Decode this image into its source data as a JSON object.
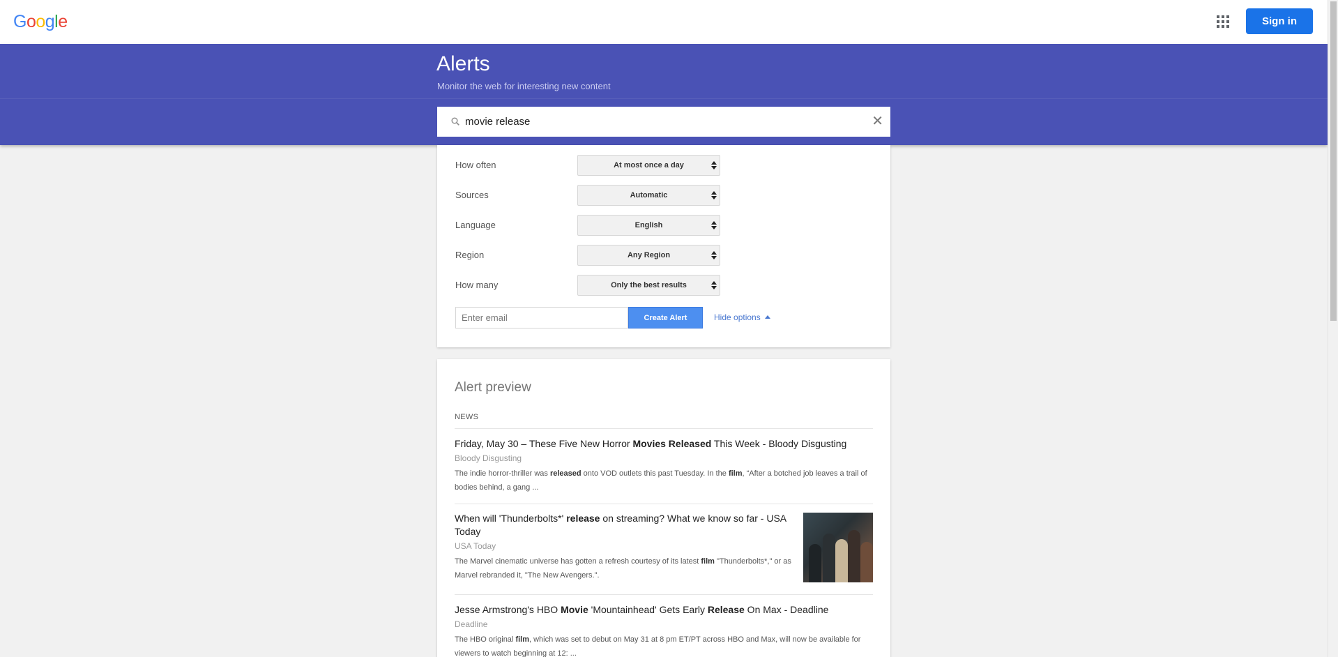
{
  "header": {
    "logo_letters": [
      "G",
      "o",
      "o",
      "g",
      "l",
      "e"
    ],
    "signin_label": "Sign in"
  },
  "banner": {
    "title": "Alerts",
    "subtitle": "Monitor the web for interesting new content",
    "search_value": "movie release",
    "clear_symbol": "✕"
  },
  "options": {
    "rows": [
      {
        "label": "How often",
        "value": "At most once a day"
      },
      {
        "label": "Sources",
        "value": "Automatic"
      },
      {
        "label": "Language",
        "value": "English"
      },
      {
        "label": "Region",
        "value": "Any Region"
      },
      {
        "label": "How many",
        "value": "Only the best results"
      }
    ],
    "email_placeholder": "Enter email",
    "create_label": "Create Alert",
    "hide_label": "Hide options"
  },
  "preview": {
    "title": "Alert preview",
    "section": "NEWS",
    "items": [
      {
        "headline_parts": [
          "Friday, May 30 – These Five New Horror ",
          "Movies Released",
          " This Week - Bloody Disgusting"
        ],
        "source": "Bloody Disgusting",
        "snippet_parts": [
          "The indie horror-thriller was ",
          "released",
          " onto VOD outlets this past Tuesday. In the ",
          "film",
          ", “After a botched job leaves a trail of bodies behind, a gang ..."
        ]
      },
      {
        "headline_parts": [
          "When will 'Thunderbolts*' ",
          "release",
          " on streaming? What we know so far - USA Today"
        ],
        "source": "USA Today",
        "snippet_parts": [
          "The Marvel cinematic universe has gotten a refresh courtesy of its latest ",
          "film",
          " \"Thunderbolts*,\" or as Marvel rebranded it, \"The New Avengers.\"."
        ]
      },
      {
        "headline_parts": [
          "Jesse Armstrong's HBO ",
          "Movie",
          " 'Mountainhead' Gets Early ",
          "Release",
          " On Max - Deadline"
        ],
        "source": "Deadline",
        "snippet_parts": [
          "The HBO original ",
          "film",
          ", which was set to debut on May 31 at 8 pm ET/PT across HBO and Max, will now be available for viewers to watch beginning at 12: ..."
        ]
      }
    ]
  },
  "colors": {
    "banner": "#4a52b5",
    "signin": "#1a73e8",
    "create_alert": "#4d8ff0",
    "link": "#4a78d0"
  }
}
